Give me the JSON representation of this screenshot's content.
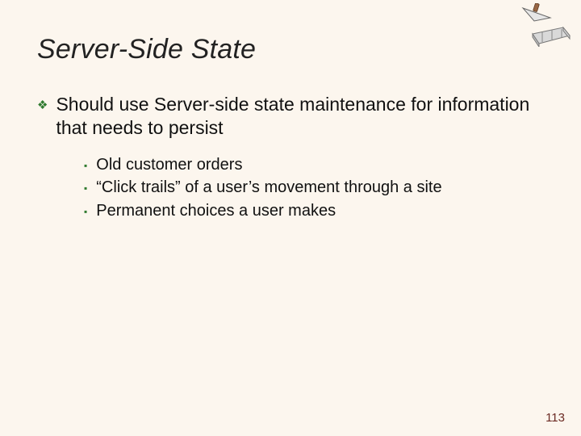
{
  "title": "Server-Side State",
  "level1": {
    "text": "Should use Server-side state maintenance for information that needs to persist"
  },
  "level2": [
    "Old customer orders",
    "“Click trails” of a user’s movement through a site",
    "Permanent choices a user makes"
  ],
  "pageNumber": "113"
}
